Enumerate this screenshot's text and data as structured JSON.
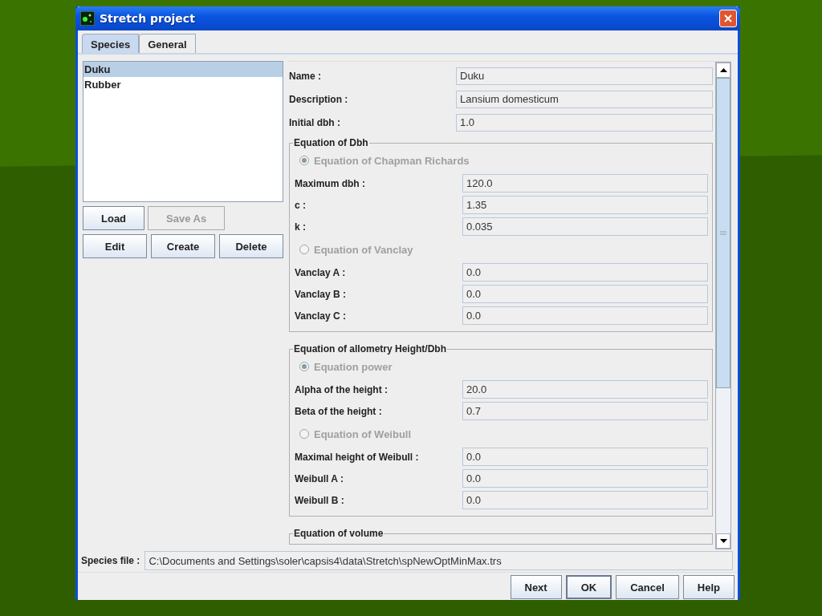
{
  "window": {
    "title": "Stretch project"
  },
  "tabs": [
    {
      "label": "Species",
      "selected": true
    },
    {
      "label": "General",
      "selected": false
    }
  ],
  "species_list": [
    {
      "label": "Duku",
      "selected": true
    },
    {
      "label": "Rubber",
      "selected": false
    }
  ],
  "list_buttons": [
    [
      {
        "label": "Load",
        "disabled": false
      },
      {
        "label": "Save As",
        "disabled": true
      }
    ],
    [
      {
        "label": "Edit",
        "disabled": false
      },
      {
        "label": "Create",
        "disabled": false
      },
      {
        "label": "Delete",
        "disabled": false
      }
    ]
  ],
  "fields": [
    {
      "label": "Name :",
      "value": "Duku"
    },
    {
      "label": "Description :",
      "value": "Lansium domesticum"
    },
    {
      "label": "Initial dbh :",
      "value": "1.0"
    }
  ],
  "groups": [
    {
      "title": "Equation of Dbh",
      "rows": [
        {
          "kind": "radio",
          "label": "Equation of Chapman Richards",
          "selected": true,
          "disabled": true
        },
        {
          "kind": "field",
          "label": "Maximum dbh :",
          "value": "120.0"
        },
        {
          "kind": "field",
          "label": "c :",
          "value": "1.35"
        },
        {
          "kind": "field",
          "label": "k :",
          "value": "0.035"
        },
        {
          "kind": "radio",
          "label": "Equation of Vanclay",
          "selected": false,
          "disabled": true
        },
        {
          "kind": "field",
          "label": "Vanclay A :",
          "value": "0.0"
        },
        {
          "kind": "field",
          "label": "Vanclay B :",
          "value": "0.0"
        },
        {
          "kind": "field",
          "label": "Vanclay C :",
          "value": "0.0"
        }
      ]
    },
    {
      "title": "Equation of allometry Height/Dbh",
      "rows": [
        {
          "kind": "radio",
          "label": "Equation power",
          "selected": true,
          "disabled": true
        },
        {
          "kind": "field",
          "label": "Alpha of the height :",
          "value": "20.0"
        },
        {
          "kind": "field",
          "label": "Beta of the height :",
          "value": "0.7"
        },
        {
          "kind": "radio",
          "label": "Equation of Weibull",
          "selected": false,
          "disabled": true
        },
        {
          "kind": "field",
          "label": "Maximal height of Weibull :",
          "value": "0.0"
        },
        {
          "kind": "field",
          "label": "Weibull A :",
          "value": "0.0"
        },
        {
          "kind": "field",
          "label": "Weibull B :",
          "value": "0.0"
        }
      ]
    },
    {
      "title": "Equation of volume"
    }
  ],
  "species_file": {
    "label": "Species file :",
    "value": "C:\\Documents and Settings\\soler\\capsis4\\data\\Stretch\\spNewOptMinMax.trs"
  },
  "dialog_buttons": [
    {
      "label": "Next",
      "default": false
    },
    {
      "label": "OK",
      "default": true
    },
    {
      "label": "Cancel",
      "default": false
    },
    {
      "label": "Help",
      "default": false
    }
  ]
}
